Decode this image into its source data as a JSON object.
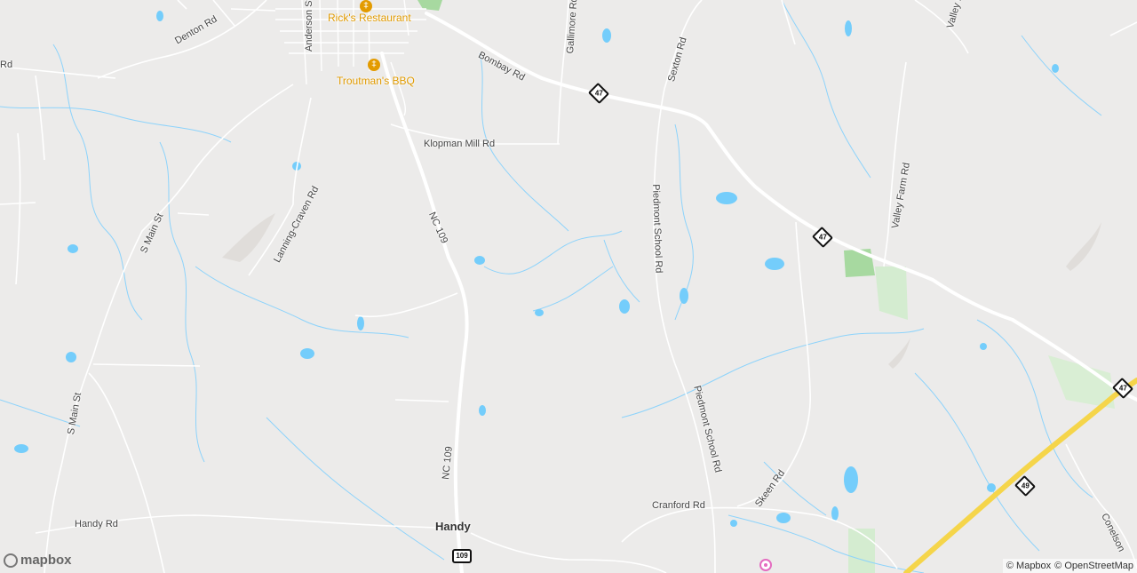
{
  "map": {
    "colors": {
      "land": "#ecebea",
      "water": "#74cdfb",
      "road": "#ffffff",
      "highway": "#f5d54a",
      "park": "#a7d9a0",
      "poi": "#e39b00"
    },
    "road_labels": {
      "denton": "Denton Rd",
      "anderson": "Anderson St",
      "bombay": "Bombay Rd",
      "gallimore": "Gallimore Rd",
      "sexton": "Sexton Rd",
      "valley_top": "Valley F",
      "klopman": "Klopman Mill Rd",
      "nc109_upper": "NC 109",
      "nc109_lower": "NC 109",
      "lanning": "Lanning-Craven Rd",
      "smain_upper": "S Main St",
      "smain_lower": "S Main St",
      "piedmont_upper": "Piedmont School Rd",
      "piedmont_lower": "Piedmont School Rd",
      "valley_farm": "Valley Farm Rd",
      "skeen": "Skeen Rd",
      "cranford": "Cranford Rd",
      "handy_rd": "Handy Rd",
      "conelson": "Conelson",
      "rd_left": "Rd"
    },
    "pois": {
      "ricks": "Rick's Restaurant",
      "troutmans": "Troutman's BBQ"
    },
    "places": {
      "handy": "Handy"
    },
    "shields": {
      "s47_a": "47",
      "s47_b": "47",
      "s47_c": "47",
      "s49": "49",
      "s109": "109"
    },
    "icons": {
      "restaurant": "fork-knife-icon",
      "attraction": "pink-marker-icon"
    }
  },
  "logo": {
    "text": "mapbox"
  },
  "attribution": {
    "mapbox": "© Mapbox",
    "osm": "© OpenStreetMap"
  }
}
